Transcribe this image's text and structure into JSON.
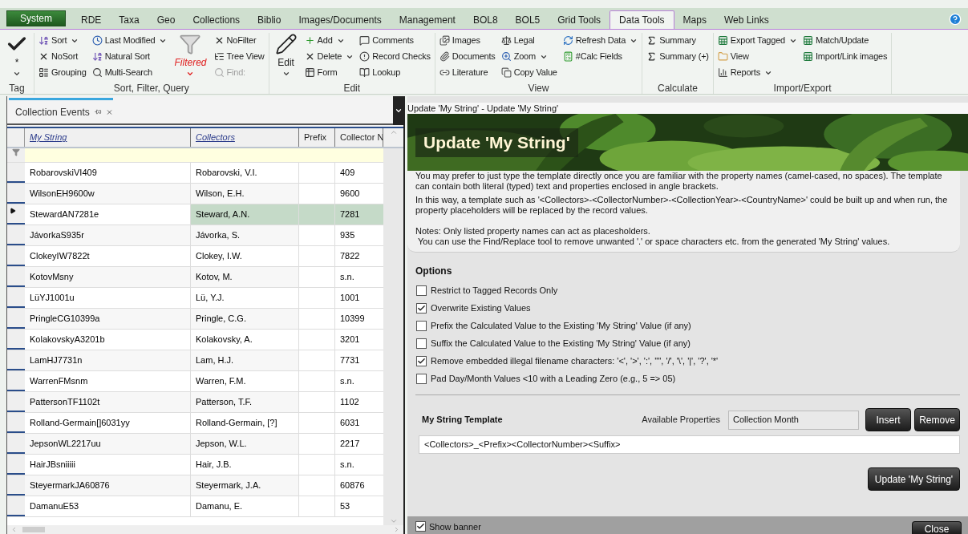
{
  "app_tabs": [
    {
      "label": "System",
      "kind": "app",
      "selected": false
    },
    {
      "label": "RDE",
      "kind": "tab",
      "selected": false
    },
    {
      "label": "Taxa",
      "kind": "tab",
      "selected": false
    },
    {
      "label": "Geo",
      "kind": "tab",
      "selected": false
    },
    {
      "label": "Collections",
      "kind": "tab",
      "selected": false
    },
    {
      "label": "Biblio",
      "kind": "tab",
      "selected": false
    },
    {
      "label": "Images/Documents",
      "kind": "tab",
      "selected": false
    },
    {
      "label": "Management",
      "kind": "tab",
      "selected": false
    },
    {
      "label": "BOL8",
      "kind": "tab",
      "selected": false
    },
    {
      "label": "BOL5",
      "kind": "tab",
      "selected": false
    },
    {
      "label": "Grid Tools",
      "kind": "tab",
      "selected": false
    },
    {
      "label": "Data Tools",
      "kind": "tab",
      "selected": true
    },
    {
      "label": "Maps",
      "kind": "tab",
      "selected": false
    },
    {
      "label": "Web Links",
      "kind": "tab",
      "selected": false
    }
  ],
  "ribbon": {
    "groups": [
      {
        "label": "Tag",
        "blocks": [
          {
            "kind": "large",
            "label": "*",
            "dropdown": true,
            "active": false
          }
        ]
      },
      {
        "label": "Sort, Filter, Query",
        "blocks": [
          {
            "kind": "column",
            "items": [
              {
                "label": "Sort",
                "dropdown": true,
                "disabled": false
              },
              {
                "label": "NoSort",
                "dropdown": false,
                "disabled": false
              },
              {
                "label": "Grouping",
                "dropdown": false,
                "disabled": false
              }
            ]
          },
          {
            "kind": "column",
            "items": [
              {
                "label": "Last Modified",
                "dropdown": true,
                "disabled": false
              },
              {
                "label": "Natural Sort",
                "dropdown": false,
                "disabled": false
              },
              {
                "label": "Multi-Search",
                "dropdown": false,
                "disabled": false
              }
            ]
          },
          {
            "kind": "large",
            "label": "Filtered",
            "dropdown": true,
            "active": true
          },
          {
            "kind": "column",
            "items": [
              {
                "label": "NoFilter",
                "dropdown": false,
                "disabled": false
              },
              {
                "label": "Tree View",
                "dropdown": false,
                "disabled": false
              },
              {
                "label": "Find:",
                "dropdown": false,
                "disabled": true
              }
            ]
          }
        ]
      },
      {
        "label": "Edit",
        "blocks": [
          {
            "kind": "large",
            "label": "Edit",
            "dropdown": true,
            "active": false
          },
          {
            "kind": "column",
            "items": [
              {
                "label": "Add",
                "dropdown": true,
                "disabled": false
              },
              {
                "label": "Delete",
                "dropdown": true,
                "disabled": false
              },
              {
                "label": "Form",
                "dropdown": false,
                "disabled": false
              }
            ]
          },
          {
            "kind": "column",
            "items": [
              {
                "label": "Comments",
                "dropdown": false,
                "disabled": false
              },
              {
                "label": "Record Checks",
                "dropdown": false,
                "disabled": false
              },
              {
                "label": "Lookup",
                "dropdown": false,
                "disabled": false
              }
            ]
          }
        ]
      },
      {
        "label": "View",
        "blocks": [
          {
            "kind": "column",
            "items": [
              {
                "label": "Images",
                "dropdown": false,
                "disabled": false
              },
              {
                "label": "Documents",
                "dropdown": false,
                "disabled": false
              },
              {
                "label": "Literature",
                "dropdown": false,
                "disabled": false
              }
            ]
          },
          {
            "kind": "column",
            "items": [
              {
                "label": "Legal",
                "dropdown": false,
                "disabled": false
              },
              {
                "label": "Zoom",
                "dropdown": true,
                "disabled": false
              },
              {
                "label": "Copy Value",
                "dropdown": false,
                "disabled": false
              }
            ]
          },
          {
            "kind": "column",
            "items": [
              {
                "label": "Refresh Data",
                "dropdown": true,
                "disabled": false
              },
              {
                "label": "#Calc Fields",
                "dropdown": false,
                "disabled": false
              }
            ]
          }
        ]
      },
      {
        "label": "Calculate",
        "blocks": [
          {
            "kind": "column",
            "items": [
              {
                "label": "Summary",
                "dropdown": false,
                "disabled": false
              },
              {
                "label": "Summary (+)",
                "dropdown": false,
                "disabled": false
              }
            ]
          }
        ]
      },
      {
        "label": "Import/Export",
        "blocks": [
          {
            "kind": "column",
            "items": [
              {
                "label": "Export Tagged",
                "dropdown": true,
                "disabled": false
              },
              {
                "label": "View",
                "dropdown": false,
                "disabled": false
              },
              {
                "label": "Reports",
                "dropdown": true,
                "disabled": false
              }
            ]
          },
          {
            "kind": "column",
            "items": [
              {
                "label": "Match/Update",
                "dropdown": false,
                "disabled": false
              },
              {
                "label": "Import/Link images",
                "dropdown": false,
                "disabled": false
              }
            ]
          }
        ]
      }
    ]
  },
  "left_panel": {
    "tab": "Collection Events",
    "columns": [
      {
        "label": "My String",
        "sorted": true
      },
      {
        "label": "Collectors",
        "sorted": true
      },
      {
        "label": "Prefix",
        "sorted": false
      },
      {
        "label": "Collector N",
        "sorted": false
      }
    ],
    "rows": [
      {
        "my_string": "RobarovskiVI409",
        "collectors": "Robarovski, V.I.",
        "collector_number": "409",
        "selected": false
      },
      {
        "my_string": "WilsonEH9600w",
        "collectors": "Wilson, E.H.",
        "collector_number": "9600",
        "selected": false
      },
      {
        "my_string": "StewardAN7281e",
        "collectors": "Steward, A.N.",
        "collector_number": "7281",
        "selected": true
      },
      {
        "my_string": "JávorkaS935r",
        "collectors": "Jávorka, S.",
        "collector_number": "935",
        "selected": false
      },
      {
        "my_string": "ClokeyIW7822t",
        "collectors": "Clokey, I.W.",
        "collector_number": "7822",
        "selected": false
      },
      {
        "my_string": "KotovMsny",
        "collectors": "Kotov, M.",
        "collector_number": "s.n.",
        "selected": false
      },
      {
        "my_string": "LüYJ1001u",
        "collectors": "Lü, Y.J.",
        "collector_number": "1001",
        "selected": false
      },
      {
        "my_string": "PringleCG10399a",
        "collectors": "Pringle, C.G.",
        "collector_number": "10399",
        "selected": false
      },
      {
        "my_string": "KolakovskyA3201b",
        "collectors": "Kolakovsky, A.",
        "collector_number": "3201",
        "selected": false
      },
      {
        "my_string": "LamHJ7731n",
        "collectors": "Lam, H.J.",
        "collector_number": "7731",
        "selected": false
      },
      {
        "my_string": "WarrenFMsnm",
        "collectors": "Warren, F.M.",
        "collector_number": "s.n.",
        "selected": false
      },
      {
        "my_string": "PattersonTF1102t",
        "collectors": "Patterson, T.F.",
        "collector_number": "1102",
        "selected": false
      },
      {
        "my_string": "Rolland-Germain[]6031yy",
        "collectors": "Rolland-Germain, [?]",
        "collector_number": "6031",
        "selected": false
      },
      {
        "my_string": "JepsonWL2217uu",
        "collectors": "Jepson, W.L.",
        "collector_number": "2217",
        "selected": false
      },
      {
        "my_string": "HairJBsniiiii",
        "collectors": "Hair, J.B.",
        "collector_number": "s.n.",
        "selected": false
      },
      {
        "my_string": "SteyermarkJA60876",
        "collectors": "Steyermark, J.A.",
        "collector_number": "60876",
        "selected": false
      },
      {
        "my_string": "DamanuE53",
        "collectors": "Damanu, E.",
        "collector_number": "53",
        "selected": false
      }
    ]
  },
  "right_panel": {
    "title": "Update 'My String' - Update 'My String'",
    "banner": {
      "title": "Update 'My String'",
      "kind": "picture"
    },
    "description": [
      "You may prefer to just type the template directly once you are familiar with the property names (camel-cased, no spaces). The template can contain both literal (typed) text and properties enclosed in angle brackets.",
      "In this way, a template such as '<Collectors>-<CollectorNumber>-<CollectionYear>-<CountryName>' could be built up and when run, the property placeholders will be replaced by the record values.",
      "Notes: Only listed property names can act as placesholders.",
      "You can use the Find/Replace tool to remove unwanted '.' or space characters etc. from the generated 'My String' values."
    ],
    "options_heading": "Options",
    "options": [
      {
        "label": "Restrict to Tagged Records Only",
        "checked": false
      },
      {
        "label": "Overwrite Existing Values",
        "checked": true
      },
      {
        "label": "Prefix the Calculated Value to the Existing 'My String' Value (if any)",
        "checked": false
      },
      {
        "label": "Suffix the Calculated Value to the Existing 'My String' Value (if any)",
        "checked": false
      },
      {
        "label": "Remove embedded illegal filename characters: '<', '>', ':', '\"', '/', '\\', '|', '?', '*'",
        "checked": true
      },
      {
        "label": "Pad Day/Month Values <10 with a Leading Zero (e.g., 5 => 05)",
        "checked": false
      }
    ],
    "template_label": "My String Template",
    "available_properties_label": "Available Properties",
    "available_properties_value": "Collection Month",
    "insert_button": "Insert",
    "remove_button": "Remove",
    "template_value": "<Collectors>_<Prefix><CollectorNumber><Suffix>",
    "update_button": "Update 'My String'",
    "show_banner": {
      "label": "Show banner",
      "checked": true
    },
    "close_button": "Close"
  }
}
